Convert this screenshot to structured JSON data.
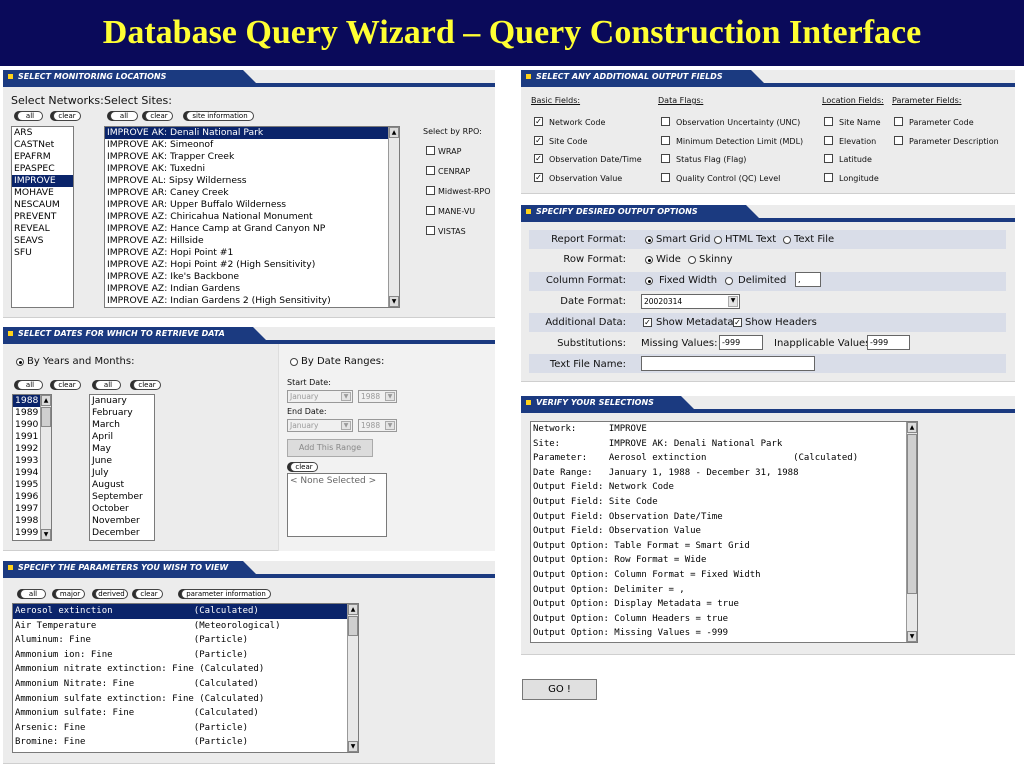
{
  "slide_title": "Database Query Wizard – Query Construction Interface",
  "locations": {
    "header": "SELECT MONITORING LOCATIONS",
    "networks_label": "Select Networks:",
    "sites_label": "Select Sites:",
    "btn_all": "all",
    "btn_clear": "clear",
    "btn_site_info": "site information",
    "networks": [
      "ARS",
      "CASTNet",
      "EPAFRM",
      "EPASPEC",
      "IMPROVE",
      "MOHAVE",
      "NESCAUM",
      "PREVENT",
      "REVEAL",
      "SEAVS",
      "SFU"
    ],
    "selected_network": "IMPROVE",
    "sites": [
      "IMPROVE AK: Denali National Park",
      "IMPROVE AK: Simeonof",
      "IMPROVE AK: Trapper Creek",
      "IMPROVE AK: Tuxedni",
      "IMPROVE AL: Sipsy Wilderness",
      "IMPROVE AR: Caney Creek",
      "IMPROVE AR: Upper Buffalo Wilderness",
      "IMPROVE AZ: Chiricahua National Monument",
      "IMPROVE AZ: Hance Camp at Grand Canyon NP",
      "IMPROVE AZ: Hillside",
      "IMPROVE AZ: Hopi Point #1",
      "IMPROVE AZ: Hopi Point #2 (High Sensitivity)",
      "IMPROVE AZ: Ike's Backbone",
      "IMPROVE AZ: Indian Gardens",
      "IMPROVE AZ: Indian Gardens 2 (High Sensitivity)"
    ],
    "selected_site": "IMPROVE AK: Denali National Park",
    "rpo_label": "Select by RPO:",
    "rpos": [
      "WRAP",
      "CENRAP",
      "Midwest-RPO",
      "MANE-VU",
      "VISTAS"
    ]
  },
  "dates": {
    "header": "SELECT DATES FOR WHICH TO RETRIEVE DATA",
    "by_years_label": "By Years and Months:",
    "by_ranges_label": "By Date Ranges:",
    "years": [
      "1988",
      "1989",
      "1990",
      "1991",
      "1992",
      "1993",
      "1994",
      "1995",
      "1996",
      "1997",
      "1998",
      "1999"
    ],
    "selected_year": "1988",
    "months": [
      "January",
      "February",
      "March",
      "April",
      "May",
      "June",
      "July",
      "August",
      "September",
      "October",
      "November",
      "December"
    ],
    "start_label": "Start Date:",
    "end_label": "End Date:",
    "start_month": "January",
    "start_year": "1988",
    "end_month": "January",
    "end_year": "1988",
    "add_range": "Add This Range",
    "none_selected": "< None Selected >"
  },
  "params": {
    "header": "SPECIFY THE PARAMETERS YOU WISH TO VIEW",
    "btn_major": "major",
    "btn_derived": "derived",
    "btn_param_info": "parameter information",
    "items": [
      "Aerosol extinction               (Calculated)",
      "Air Temperature                  (Meteorological)",
      "Aluminum: Fine                   (Particle)",
      "Ammonium ion: Fine               (Particle)",
      "Ammonium nitrate extinction: Fine (Calculated)",
      "Ammonium Nitrate: Fine           (Calculated)",
      "Ammonium sulfate extinction: Fine (Calculated)",
      "Ammonium sulfate: Fine           (Calculated)",
      "Arsenic: Fine                    (Particle)",
      "Bromine: Fine                    (Particle)"
    ]
  },
  "output_fields": {
    "header": "SELECT ANY ADDITIONAL OUTPUT FIELDS",
    "basic_label": "Basic Fields:",
    "flags_label": "Data Flags:",
    "loc_label": "Location Fields:",
    "param_label": "Parameter Fields:",
    "basic": [
      {
        "t": "Network Code",
        "c": true
      },
      {
        "t": "Site Code",
        "c": true
      },
      {
        "t": "Observation Date/Time",
        "c": true
      },
      {
        "t": "Observation Value",
        "c": true
      }
    ],
    "flags": [
      {
        "t": "Observation Uncertainty (UNC)",
        "c": false
      },
      {
        "t": "Minimum Detection Limit (MDL)",
        "c": false
      },
      {
        "t": "Status Flag (Flag)",
        "c": false
      },
      {
        "t": "Quality Control (QC) Level",
        "c": false
      }
    ],
    "loc": [
      {
        "t": "Site Name",
        "c": false
      },
      {
        "t": "Elevation",
        "c": false
      },
      {
        "t": "Latitude",
        "c": false
      },
      {
        "t": "Longitude",
        "c": false
      }
    ],
    "param": [
      {
        "t": "Parameter Code",
        "c": false
      },
      {
        "t": "Parameter Description",
        "c": false
      }
    ]
  },
  "output_options": {
    "header": "SPECIFY DESIRED OUTPUT OPTIONS",
    "report_format": "Report Format:",
    "rf_smart": "Smart Grid",
    "rf_html": "HTML Text",
    "rf_text": "Text File",
    "row_format": "Row Format:",
    "row_wide": "Wide",
    "row_skinny": "Skinny",
    "column_format": "Column Format:",
    "col_fixed": "Fixed Width",
    "col_delim": "Delimited",
    "delimiter": ",",
    "date_format": "Date Format:",
    "date_value": "20020314",
    "additional_data": "Additional Data:",
    "show_metadata": "Show Metadata",
    "show_headers": "Show Headers",
    "substitutions": "Substitutions:",
    "missing_label": "Missing Values:",
    "missing_value": "-999",
    "inapplicable_label": "Inapplicable Values:",
    "inapplicable_value": "-999",
    "text_file_name": "Text File Name:"
  },
  "verify": {
    "header": "VERIFY YOUR SELECTIONS",
    "lines": [
      "Network:      IMPROVE",
      "Site:         IMPROVE AK: Denali National Park",
      "Parameter:    Aerosol extinction                (Calculated)",
      "Date Range:   January 1, 1988 - December 31, 1988",
      "Output Field: Network Code",
      "Output Field: Site Code",
      "Output Field: Observation Date/Time",
      "Output Field: Observation Value",
      "Output Option: Table Format = Smart Grid",
      "Output Option: Row Format = Wide",
      "Output Option: Column Format = Fixed Width",
      "Output Option: Delimiter = ,",
      "Output Option: Display Metadata = true",
      "Output Option: Column Headers = true",
      "Output Option: Missing Values = -999"
    ]
  },
  "go_button": "GO !"
}
